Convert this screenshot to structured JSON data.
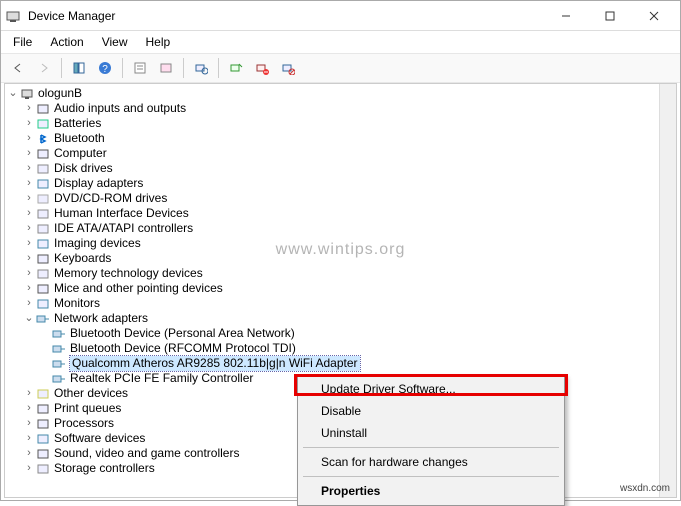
{
  "window": {
    "title": "Device Manager"
  },
  "menu": {
    "file": "File",
    "action": "Action",
    "view": "View",
    "help": "Help"
  },
  "root": "ologunB",
  "categories": [
    {
      "label": "Audio inputs and outputs",
      "expanded": false,
      "icon": "audio"
    },
    {
      "label": "Batteries",
      "expanded": false,
      "icon": "battery"
    },
    {
      "label": "Bluetooth",
      "expanded": false,
      "icon": "bt"
    },
    {
      "label": "Computer",
      "expanded": false,
      "icon": "pc"
    },
    {
      "label": "Disk drives",
      "expanded": false,
      "icon": "disk"
    },
    {
      "label": "Display adapters",
      "expanded": false,
      "icon": "display"
    },
    {
      "label": "DVD/CD-ROM drives",
      "expanded": false,
      "icon": "cd"
    },
    {
      "label": "Human Interface Devices",
      "expanded": false,
      "icon": "hid"
    },
    {
      "label": "IDE ATA/ATAPI controllers",
      "expanded": false,
      "icon": "ide"
    },
    {
      "label": "Imaging devices",
      "expanded": false,
      "icon": "imaging"
    },
    {
      "label": "Keyboards",
      "expanded": false,
      "icon": "keyboard"
    },
    {
      "label": "Memory technology devices",
      "expanded": false,
      "icon": "mem"
    },
    {
      "label": "Mice and other pointing devices",
      "expanded": false,
      "icon": "mouse"
    },
    {
      "label": "Monitors",
      "expanded": false,
      "icon": "monitor"
    },
    {
      "label": "Network adapters",
      "expanded": true,
      "icon": "net",
      "children": [
        {
          "label": "Bluetooth Device (Personal Area Network)",
          "icon": "net"
        },
        {
          "label": "Bluetooth Device (RFCOMM Protocol TDI)",
          "icon": "net"
        },
        {
          "label": "Qualcomm Atheros AR9285 802.11b|g|n WiFi Adapter",
          "icon": "net",
          "selected": true
        },
        {
          "label": "Realtek PCIe FE Family Controller",
          "icon": "net"
        }
      ]
    },
    {
      "label": "Other devices",
      "expanded": false,
      "icon": "other"
    },
    {
      "label": "Print queues",
      "expanded": false,
      "icon": "print"
    },
    {
      "label": "Processors",
      "expanded": false,
      "icon": "cpu"
    },
    {
      "label": "Software devices",
      "expanded": false,
      "icon": "soft"
    },
    {
      "label": "Sound, video and game controllers",
      "expanded": false,
      "icon": "sound"
    },
    {
      "label": "Storage controllers",
      "expanded": false,
      "icon": "storage"
    }
  ],
  "contextMenu": {
    "items": [
      {
        "label": "Update Driver Software...",
        "sep": false
      },
      {
        "label": "Disable",
        "sep": false
      },
      {
        "label": "Uninstall",
        "sep": false
      },
      {
        "label": "",
        "sep": true
      },
      {
        "label": "Scan for hardware changes",
        "sep": false
      },
      {
        "label": "",
        "sep": true
      },
      {
        "label": "Properties",
        "sep": false,
        "bold": true
      }
    ]
  },
  "watermark": "www.wintips.org",
  "footer": "wsxdn.com"
}
